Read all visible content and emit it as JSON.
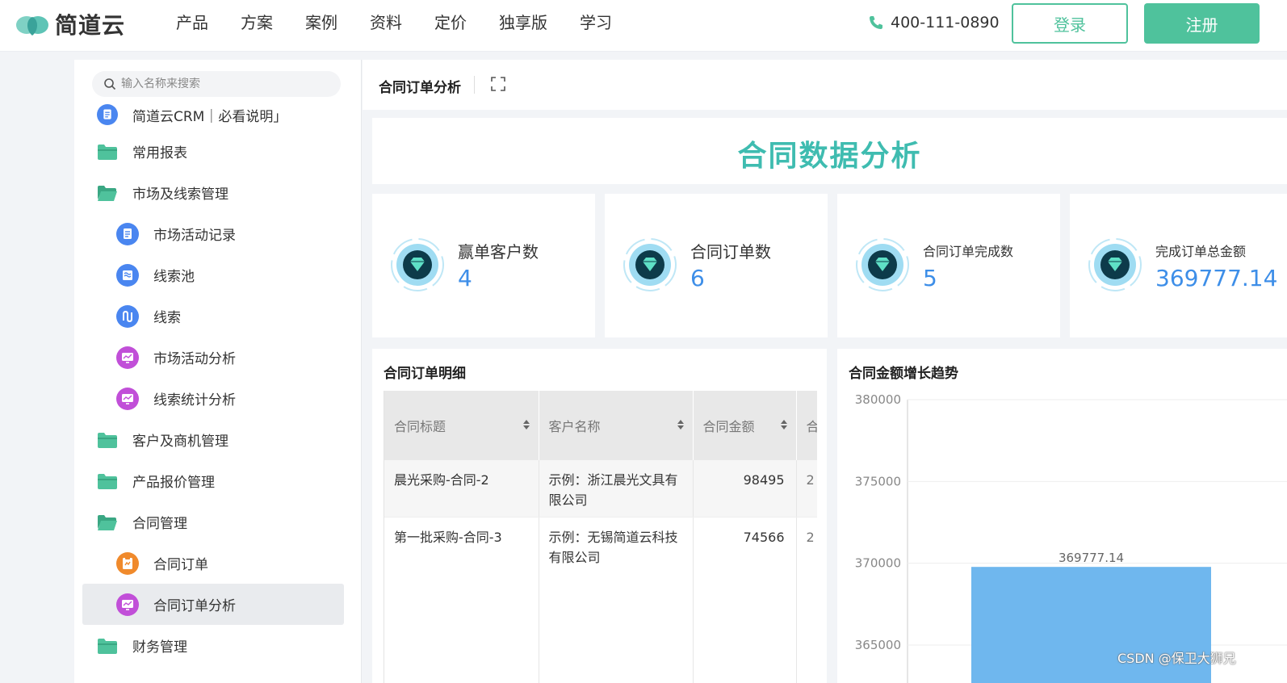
{
  "brand": {
    "name": "简道云",
    "accent": "#4fc29c"
  },
  "nav": {
    "items": [
      "产品",
      "方案",
      "案例",
      "资料",
      "定价",
      "独享版",
      "学习"
    ],
    "phone": "400-111-0890",
    "login": "登录",
    "register": "注册"
  },
  "sidebar": {
    "search_placeholder": "输入名称来搜索",
    "items": [
      {
        "label": "简道云CRM｜必看说明｣",
        "icon": "document-icon",
        "level": 1
      },
      {
        "label": "常用报表",
        "icon": "folder-icon",
        "level": 1
      },
      {
        "label": "市场及线索管理",
        "icon": "folder-open-icon",
        "level": 1
      },
      {
        "label": "市场活动记录",
        "icon": "form-icon",
        "level": 2
      },
      {
        "label": "线索池",
        "icon": "list-icon",
        "level": 2
      },
      {
        "label": "线索",
        "icon": "flow-icon",
        "level": 2
      },
      {
        "label": "市场活动分析",
        "icon": "dashboard-icon",
        "level": 2
      },
      {
        "label": "线索统计分析",
        "icon": "dashboard-icon",
        "level": 2
      },
      {
        "label": "客户及商机管理",
        "icon": "folder-icon",
        "level": 1
      },
      {
        "label": "产品报价管理",
        "icon": "folder-icon",
        "level": 1
      },
      {
        "label": "合同管理",
        "icon": "folder-open-icon",
        "level": 1
      },
      {
        "label": "合同订单",
        "icon": "order-icon",
        "level": 2
      },
      {
        "label": "合同订单分析",
        "icon": "dashboard-icon",
        "level": 2,
        "active": true
      },
      {
        "label": "财务管理",
        "icon": "folder-icon",
        "level": 1
      }
    ]
  },
  "main": {
    "title": "合同订单分析",
    "banner_title": "合同数据分析",
    "kpis": [
      {
        "label": "赢单客户数",
        "value": "4"
      },
      {
        "label": "合同订单数",
        "value": "6"
      },
      {
        "label": "合同订单完成数",
        "value": "5"
      },
      {
        "label": "完成订单总金额",
        "value": "369777.14"
      }
    ],
    "table": {
      "title": "合同订单明细",
      "columns": [
        "合同标题",
        "客户名称",
        "合同金额",
        "合"
      ],
      "rows": [
        [
          "晨光采购-合同-2",
          "示例：浙江晨光文具有限公司",
          "98495",
          "2"
        ],
        [
          "第一批采购-合同-3",
          "示例：无锡简道云科技有限公司",
          "74566",
          "2"
        ]
      ]
    }
  },
  "chart_data": {
    "type": "bar",
    "title": "合同金额增长趋势",
    "yticks": [
      "380000",
      "375000",
      "370000",
      "365000"
    ],
    "ylim": [
      365000,
      380000
    ],
    "series": [
      {
        "values": [
          369777.14
        ]
      }
    ],
    "data_labels": [
      "369777.14"
    ],
    "bar_color": "#6fb7ee"
  },
  "watermark": "CSDN @保卫大狮兄"
}
